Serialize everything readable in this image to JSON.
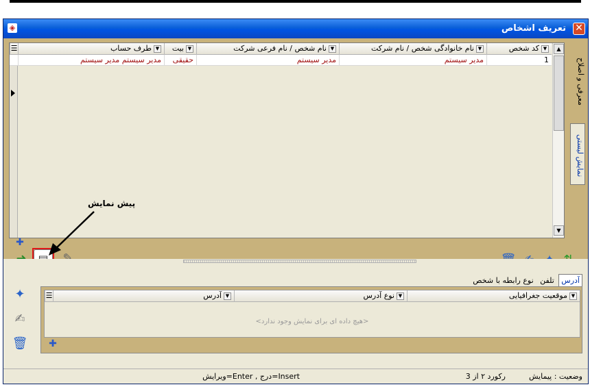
{
  "window": {
    "title": "تعریف اشخاص",
    "close_glyph": "✕"
  },
  "side_tabs": [
    "معرفی و اصلاح",
    "نمایش لیستی"
  ],
  "grid": {
    "columns": [
      "کد شخص",
      "نام خانوادگی شخص / نام شرکت",
      "نام شخص / نام فرعی شرکت",
      "بیت",
      "طرف حساب"
    ],
    "rows": [
      [
        "1",
        "مدیر سیستم",
        "مدیر سیستم",
        "حقیقی",
        "مدیر سیستم مدیر سیستم"
      ]
    ]
  },
  "annotation": {
    "label": "پیش نمایش"
  },
  "lower": {
    "tabs": [
      "آدرس",
      "تلفن",
      "نوع رابطه با شخص"
    ],
    "columns": [
      "موقعیت جغرافیایی",
      "نوع آدرس",
      "آدرس"
    ],
    "empty_message": "<هیچ داده ای برای نمایش وجود ندارد>"
  },
  "status": {
    "state": "وضعیت : پیمایش",
    "record": "رکورد ۲ از 3",
    "hint": "Insert=درج , Enter=ویرایش"
  },
  "colors": {
    "titlebar": "#0054e3",
    "toolbar_band": "#c8b27c",
    "row_text": "#a01010",
    "highlight": "#e01818"
  },
  "icons": [
    "app-icon",
    "close-icon",
    "new-record-icon",
    "exit-icon",
    "preview-icon",
    "report-icon",
    "delete-icon",
    "edit-icon",
    "add-icon",
    "navigate-icon"
  ]
}
